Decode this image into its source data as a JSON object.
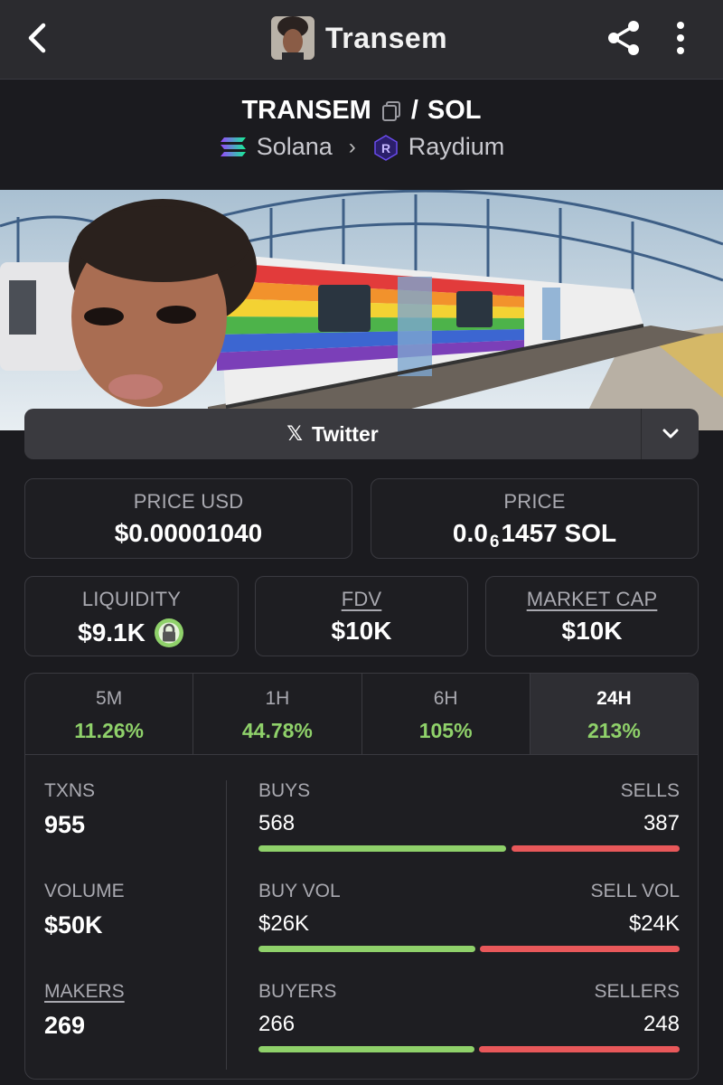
{
  "header": {
    "title": "Transem"
  },
  "pair": {
    "base": "TRANSEM",
    "separator": "/",
    "quote": "SOL",
    "chain": "Solana",
    "dex": "Raydium"
  },
  "social": {
    "twitter_label": "Twitter",
    "x_glyph": "𝕏"
  },
  "stats": {
    "price_usd_label": "PRICE USD",
    "price_usd_value": "$0.00001040",
    "price_label": "PRICE",
    "price_prefix": "0.0",
    "price_subscript": "6",
    "price_suffix": "1457 SOL",
    "liquidity_label": "LIQUIDITY",
    "liquidity_value": "$9.1K",
    "fdv_label": "FDV",
    "fdv_value": "$10K",
    "mcap_label": "MARKET CAP",
    "mcap_value": "$10K"
  },
  "timeframes": [
    {
      "label": "5M",
      "value": "11.26%"
    },
    {
      "label": "1H",
      "value": "44.78%"
    },
    {
      "label": "6H",
      "value": "105%"
    },
    {
      "label": "24H",
      "value": "213%",
      "active": true
    }
  ],
  "metrics": {
    "txns_label": "TXNS",
    "txns_value": "955",
    "volume_label": "VOLUME",
    "volume_value": "$50K",
    "makers_label": "MAKERS",
    "makers_value": "269"
  },
  "rows": {
    "buys_label": "BUYS",
    "sells_label": "SELLS",
    "buys_value": "568",
    "sells_value": "387",
    "buys_fraction": 0.595,
    "buyvol_label": "BUY VOL",
    "sellvol_label": "SELL VOL",
    "buyvol_value": "$26K",
    "sellvol_value": "$24K",
    "buyvol_fraction": 0.52,
    "buyers_label": "BUYERS",
    "sellers_label": "SELLERS",
    "buyers_value": "266",
    "sellers_value": "248",
    "buyers_fraction": 0.518
  },
  "colors": {
    "positive": "#8fd16a",
    "negative": "#e8585a",
    "background": "#1b1b1f"
  },
  "icons": [
    "back-arrow-icon",
    "share-icon",
    "kebab-menu-icon",
    "copy-icon",
    "solana-logo-icon",
    "raydium-logo-icon",
    "x-logo-icon",
    "chevron-down-icon",
    "lock-icon"
  ]
}
